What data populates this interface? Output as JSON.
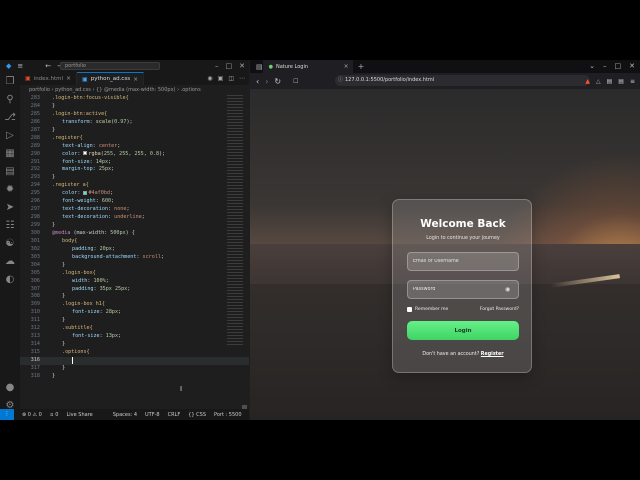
{
  "vscode": {
    "search_text": "portfolio",
    "tabs": [
      {
        "label": "index.html",
        "active": false
      },
      {
        "label": "python_ad.css",
        "active": true
      }
    ],
    "breadcrumb": "portfolio  ›  python_ad.css  ›  {} @media (max-width: 500px)  ›  .options",
    "status": {
      "errors": "⊗ 0 ⚠ 0",
      "ports": "⯏ 0",
      "live_share": "Live Share",
      "spaces": "Spaces: 4",
      "encoding": "UTF-8",
      "eol": "CRLF",
      "language": "{} CSS",
      "port": "Port : 5500"
    }
  },
  "code_lines": [
    {
      "n": "283",
      "indent": 2,
      "parts": [
        [
          ".login-btn:focus-visible{",
          "sel"
        ]
      ]
    },
    {
      "n": "284",
      "indent": 2,
      "parts": [
        [
          "}",
          "pun"
        ]
      ]
    },
    {
      "n": "285",
      "indent": 2,
      "parts": [
        [
          ".login-btn:active{",
          "sel"
        ]
      ]
    },
    {
      "n": "286",
      "indent": 3,
      "parts": [
        [
          "transform",
          "prop"
        ],
        [
          ": ",
          "pun"
        ],
        [
          "scale",
          "fn"
        ],
        [
          "(",
          "pun"
        ],
        [
          "0.97",
          "num"
        ],
        [
          ");",
          "pun"
        ]
      ]
    },
    {
      "n": "287",
      "indent": 2,
      "parts": [
        [
          "}",
          "pun"
        ]
      ]
    },
    {
      "n": "288",
      "indent": 2,
      "parts": [
        [
          ".register{",
          "sel"
        ]
      ]
    },
    {
      "n": "289",
      "indent": 3,
      "parts": [
        [
          "text-align",
          "prop"
        ],
        [
          ": ",
          "pun"
        ],
        [
          "center",
          "val"
        ],
        [
          ";",
          "pun"
        ]
      ]
    },
    {
      "n": "290",
      "indent": 3,
      "swatch": "#ffffff",
      "parts": [
        [
          "color",
          "prop"
        ],
        [
          ": ",
          "pun"
        ],
        [
          "rgba",
          "fn"
        ],
        [
          "(",
          "pun"
        ],
        [
          "255, 255, 255, 0.8",
          "num"
        ],
        [
          ");",
          "pun"
        ]
      ]
    },
    {
      "n": "291",
      "indent": 3,
      "parts": [
        [
          "font-size",
          "prop"
        ],
        [
          ": ",
          "pun"
        ],
        [
          "14px",
          "num"
        ],
        [
          ";",
          "pun"
        ]
      ]
    },
    {
      "n": "292",
      "indent": 3,
      "parts": [
        [
          "margin-top",
          "prop"
        ],
        [
          ": ",
          "pun"
        ],
        [
          "25px",
          "num"
        ],
        [
          ";",
          "pun"
        ]
      ]
    },
    {
      "n": "293",
      "indent": 2,
      "parts": [
        [
          "}",
          "pun"
        ]
      ]
    },
    {
      "n": "294",
      "indent": 2,
      "parts": [
        [
          ".register a{",
          "sel"
        ]
      ]
    },
    {
      "n": "295",
      "indent": 3,
      "swatch": "#4af0bd",
      "parts": [
        [
          "color",
          "prop"
        ],
        [
          ": ",
          "pun"
        ],
        [
          "#4af0bd",
          "val"
        ],
        [
          ";",
          "pun"
        ]
      ]
    },
    {
      "n": "296",
      "indent": 3,
      "parts": [
        [
          "font-weight",
          "prop"
        ],
        [
          ": ",
          "pun"
        ],
        [
          "600",
          "num"
        ],
        [
          ";",
          "pun"
        ]
      ]
    },
    {
      "n": "297",
      "indent": 3,
      "parts": [
        [
          "text-decoration",
          "prop"
        ],
        [
          ": ",
          "pun"
        ],
        [
          "none",
          "val"
        ],
        [
          ";",
          "pun"
        ]
      ]
    },
    {
      "n": "298",
      "indent": 3,
      "parts": [
        [
          "text-decoration",
          "prop"
        ],
        [
          ": ",
          "pun"
        ],
        [
          "underline",
          "val"
        ],
        [
          ";",
          "pun"
        ]
      ]
    },
    {
      "n": "299",
      "indent": 2,
      "parts": [
        [
          "}",
          "pun"
        ]
      ]
    },
    {
      "n": "300",
      "indent": 2,
      "parts": [
        [
          "@media",
          "at"
        ],
        [
          " (max-width: ",
          "pun"
        ],
        [
          "500px",
          "num"
        ],
        [
          ") {",
          "pun"
        ]
      ]
    },
    {
      "n": "301",
      "indent": 3,
      "parts": [
        [
          "body{",
          "sel"
        ]
      ]
    },
    {
      "n": "302",
      "indent": 4,
      "parts": [
        [
          "padding",
          "prop"
        ],
        [
          ": ",
          "pun"
        ],
        [
          "20px",
          "num"
        ],
        [
          ";",
          "pun"
        ]
      ]
    },
    {
      "n": "303",
      "indent": 4,
      "parts": [
        [
          "background-attachment",
          "prop"
        ],
        [
          ": ",
          "pun"
        ],
        [
          "scroll",
          "val"
        ],
        [
          ";",
          "pun"
        ]
      ]
    },
    {
      "n": "304",
      "indent": 3,
      "parts": [
        [
          "}",
          "pun"
        ]
      ]
    },
    {
      "n": "305",
      "indent": 3,
      "parts": [
        [
          ".login-box{",
          "sel"
        ]
      ]
    },
    {
      "n": "306",
      "indent": 4,
      "parts": [
        [
          "width",
          "prop"
        ],
        [
          ": ",
          "pun"
        ],
        [
          "100%",
          "num"
        ],
        [
          ";",
          "pun"
        ]
      ]
    },
    {
      "n": "307",
      "indent": 4,
      "parts": [
        [
          "padding",
          "prop"
        ],
        [
          ": ",
          "pun"
        ],
        [
          "35px 25px",
          "num"
        ],
        [
          ";",
          "pun"
        ]
      ]
    },
    {
      "n": "308",
      "indent": 3,
      "parts": [
        [
          "}",
          "pun"
        ]
      ]
    },
    {
      "n": "309",
      "indent": 3,
      "parts": [
        [
          ".login-box h1{",
          "sel"
        ]
      ]
    },
    {
      "n": "310",
      "indent": 4,
      "parts": [
        [
          "font-size",
          "prop"
        ],
        [
          ": ",
          "pun"
        ],
        [
          "28px",
          "num"
        ],
        [
          ";",
          "pun"
        ]
      ]
    },
    {
      "n": "311",
      "indent": 3,
      "parts": [
        [
          "}",
          "pun"
        ]
      ]
    },
    {
      "n": "312",
      "indent": 3,
      "parts": [
        [
          ".subtitle{",
          "sel"
        ]
      ]
    },
    {
      "n": "313",
      "indent": 4,
      "parts": [
        [
          "font-size",
          "prop"
        ],
        [
          ": ",
          "pun"
        ],
        [
          "13px",
          "num"
        ],
        [
          ";",
          "pun"
        ]
      ]
    },
    {
      "n": "314",
      "indent": 3,
      "parts": [
        [
          "}",
          "pun"
        ]
      ]
    },
    {
      "n": "315",
      "indent": 3,
      "parts": [
        [
          ".options{",
          "sel"
        ]
      ]
    },
    {
      "n": "316",
      "indent": 4,
      "cursor": true,
      "parts": [
        [
          "",
          "pun"
        ]
      ]
    },
    {
      "n": "317",
      "indent": 3,
      "parts": [
        [
          "}",
          "pun"
        ]
      ]
    },
    {
      "n": "318",
      "indent": 2,
      "parts": [
        [
          "}",
          "pun"
        ]
      ]
    }
  ],
  "browser": {
    "tab_title": "Nature Login",
    "url": "127.0.0.1:5500/portfolio/index.html"
  },
  "login": {
    "title": "Welcome Back",
    "subtitle": "Login to continue your journey",
    "email_placeholder": "Email or Username",
    "password_placeholder": "Password",
    "remember": "Remember me",
    "forgot": "Forgot Password?",
    "button": "Login",
    "register_prompt": "Don't have an account?",
    "register_link": "Register"
  },
  "colors": {
    "vscode_bg": "#1e1e1e",
    "accent_blue": "#0078d4",
    "login_button": "#4fe174",
    "brave_orange": "#fb542b"
  },
  "icons": [
    "vscode-logo-icon",
    "explorer-icon",
    "search-icon",
    "source-control-icon",
    "run-debug-icon",
    "extensions-icon",
    "account-icon",
    "settings-icon",
    "eye-icon"
  ]
}
